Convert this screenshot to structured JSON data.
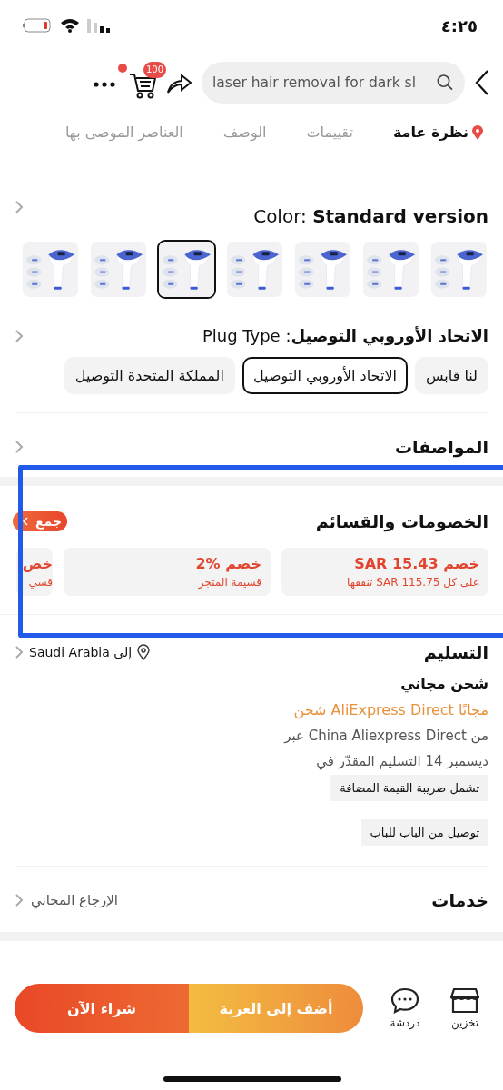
{
  "status_bar": {
    "time": "٤:٢٥"
  },
  "header": {
    "search": {
      "value": "laser hair removal for dark sl"
    },
    "cart_count": "100",
    "has_notification": true
  },
  "tabs": [
    {
      "label": "نظرة عامة",
      "selected": true
    },
    {
      "label": "تقييمات",
      "selected": false
    },
    {
      "label": "الوصف",
      "selected": false
    },
    {
      "label": "العناصر الموصى بها",
      "selected": false
    }
  ],
  "color": {
    "label": "Color:",
    "value": "Standard version",
    "options": [
      {
        "kind": "picture",
        "selected": false
      },
      {
        "kind": "picture",
        "selected": false
      },
      {
        "kind": "picture",
        "selected": false
      },
      {
        "kind": "picture",
        "selected": false
      },
      {
        "kind": "picture",
        "selected": true
      },
      {
        "kind": "picture",
        "selected": false
      },
      {
        "kind": "picture",
        "selected": false
      }
    ]
  },
  "plug": {
    "text": "**الاتحاد الأوروبي التوصيل**: Plug Type",
    "options": [
      {
        "label": "لنا قابس",
        "selected": false
      },
      {
        "label": "الاتحاد الأوروبي التوصيل",
        "selected": true
      },
      {
        "label": "المملكة المتحدة التوصيل",
        "selected": false
      }
    ]
  },
  "specs": {
    "title": "المواصفات"
  },
  "discounts": {
    "title": "الخصومات والقسائم",
    "collect": "جمع",
    "cards": [
      {
        "title": "خصم SAR 15.43",
        "subtitle": "على كل SAR 115.75 تنفقها"
      },
      {
        "title": "خصم %2",
        "subtitle": "قسيمة المتجر"
      },
      {
        "title": "خص",
        "subtitle": "قسي"
      }
    ]
  },
  "delivery": {
    "title": "التسليم",
    "destination": "إلى Saudi Arabia",
    "shipping": "شحن مجاني",
    "carrier": "مجانًا AliExpress Direct شحن",
    "route": "من China Aliexpress Direct عبر",
    "estimate": "ديسمبر 14 التسليم المقدّر في",
    "tags": [
      "تشمل ضريبة القيمة المضافة",
      "توصيل من الباب للباب"
    ]
  },
  "services": {
    "title": "خدمات",
    "value": "الإرجاع المجاني"
  },
  "bottom_bar": {
    "actions": [
      {
        "kind": "store",
        "label": "تخزين"
      },
      {
        "kind": "chat",
        "label": "دردشة"
      }
    ],
    "add_to_cart": "أضف إلى العربة",
    "buy_now": "شراء الآن"
  }
}
